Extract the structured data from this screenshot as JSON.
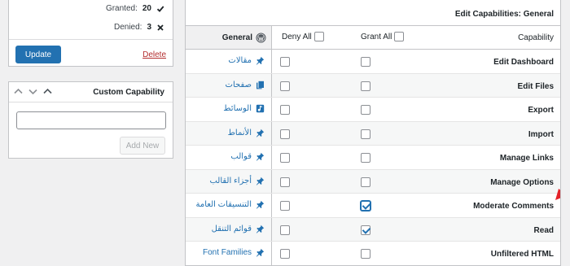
{
  "summary": {
    "granted_label": "Granted:",
    "granted_count": "20",
    "denied_label": "Denied:",
    "denied_count": "3",
    "update_button": "Update",
    "delete_link": "Delete"
  },
  "custom_capability": {
    "title": "Custom Capability",
    "input_value": "",
    "add_button": "Add New"
  },
  "capabilities_panel": {
    "title": "Edit Capabilities: General",
    "header": {
      "group_label": "General",
      "deny_all": "Deny All",
      "grant_all": "Grant All",
      "capability": "Capability"
    },
    "rows": [
      {
        "group": "مقالات",
        "icon": "pin-icon",
        "capability": "Edit Dashboard",
        "deny": false,
        "grant": false
      },
      {
        "group": "صفحات",
        "icon": "pages-icon",
        "capability": "Edit Files",
        "deny": false,
        "grant": false
      },
      {
        "group": "الوسائط",
        "icon": "media-icon",
        "capability": "Export",
        "deny": false,
        "grant": false
      },
      {
        "group": "الأنماط",
        "icon": "pin-icon",
        "capability": "Import",
        "deny": false,
        "grant": false
      },
      {
        "group": "قوالب",
        "icon": "pin-icon",
        "capability": "Manage Links",
        "deny": false,
        "grant": false
      },
      {
        "group": "أجزاء القالب",
        "icon": "pin-icon",
        "capability": "Manage Options",
        "deny": false,
        "grant": false
      },
      {
        "group": "التنسيقات العامة",
        "icon": "pin-icon",
        "capability": "Moderate Comments",
        "deny": false,
        "grant": true
      },
      {
        "group": "قوائم التنقل",
        "icon": "pin-icon",
        "capability": "Read",
        "deny": false,
        "grant": true
      },
      {
        "group": "Font Families",
        "icon": "pin-icon",
        "capability": "Unfiltered HTML",
        "deny": false,
        "grant": false
      }
    ]
  },
  "colors": {
    "accent": "#2271b1",
    "delete": "#b32d2e",
    "annotation": "#e4232a"
  }
}
